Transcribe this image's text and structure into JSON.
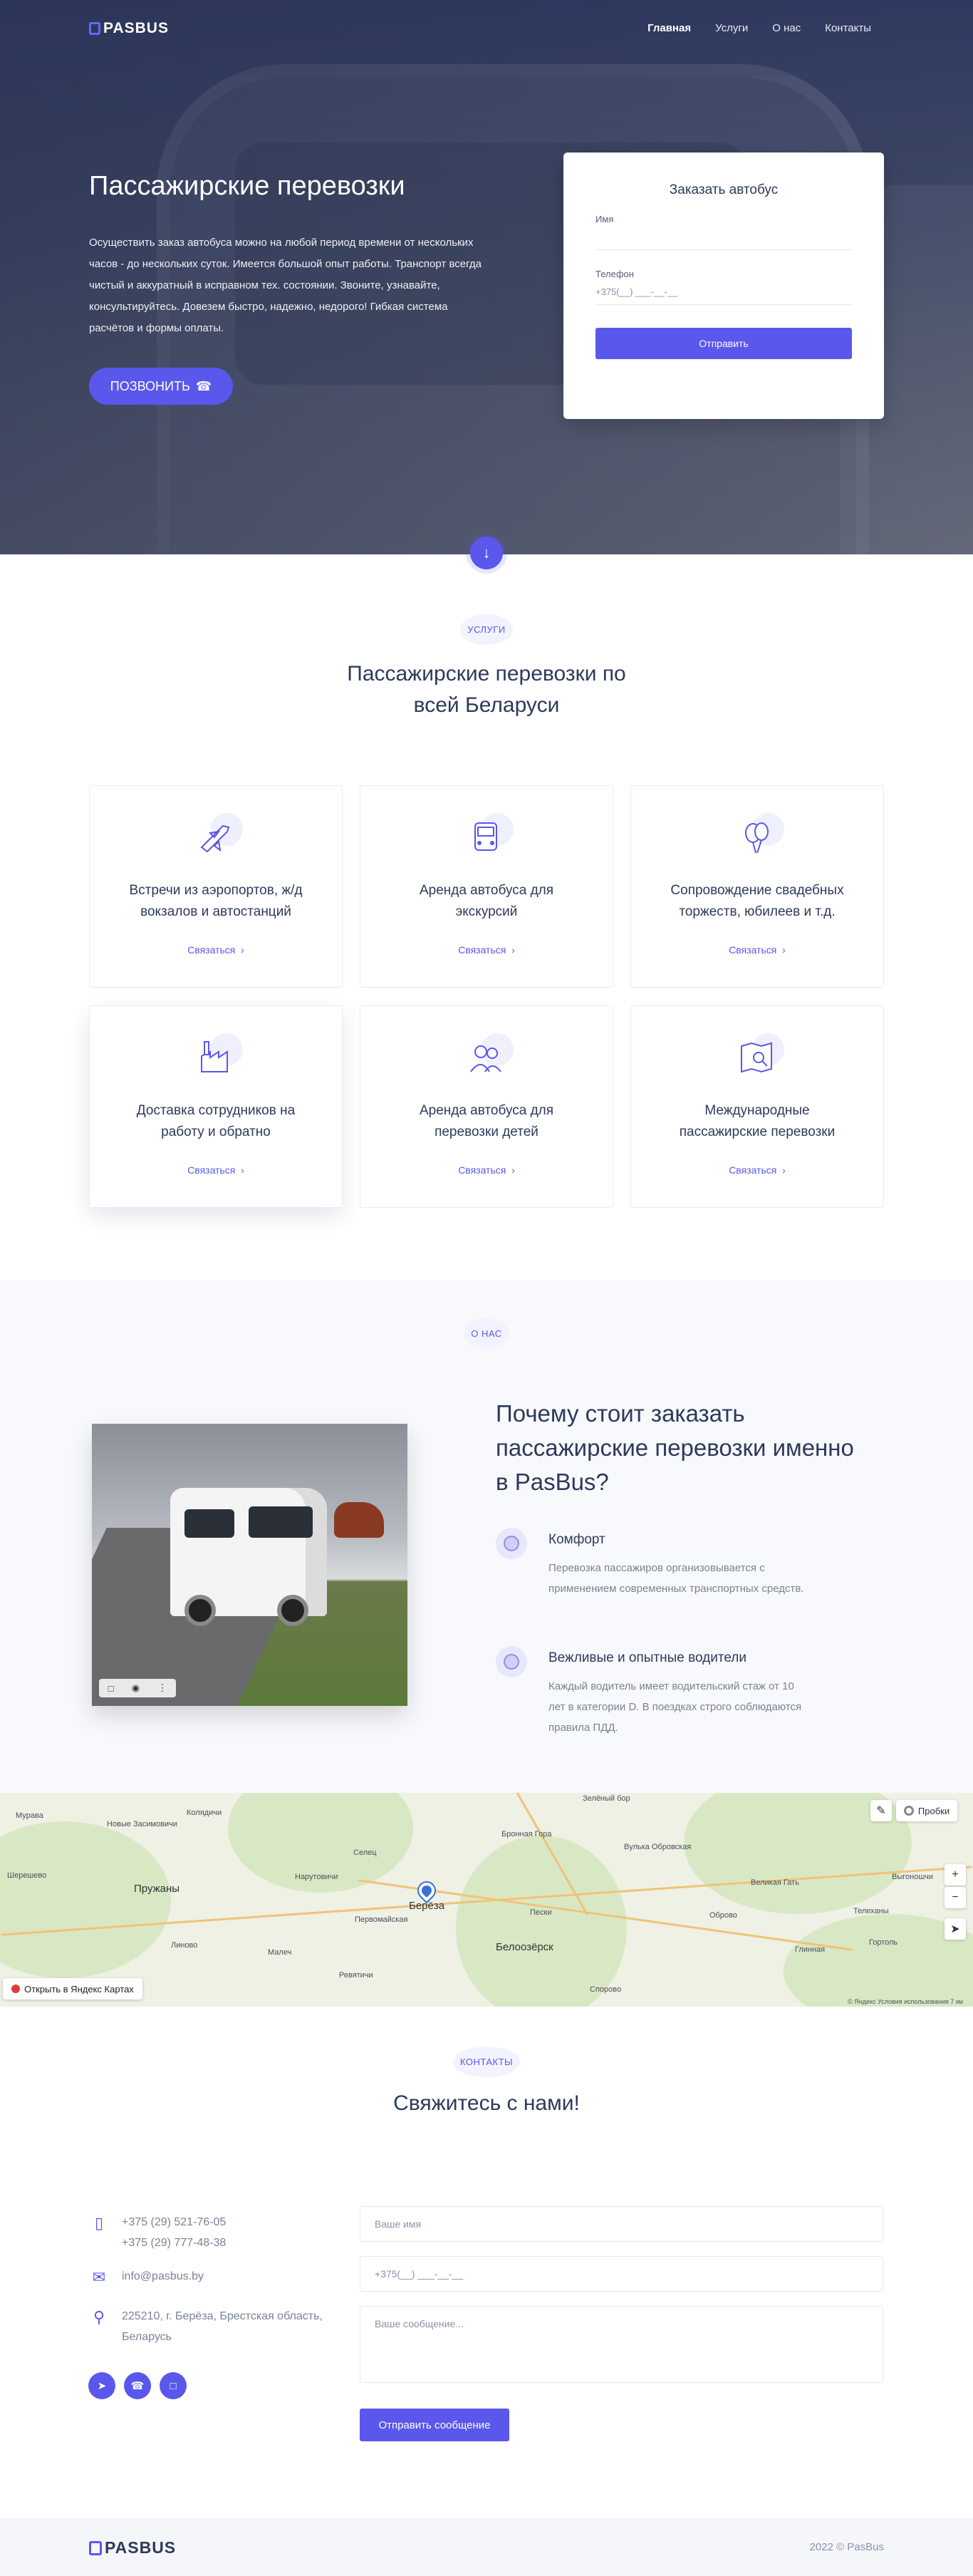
{
  "nav": {
    "logo": "PASBUS",
    "items": [
      {
        "label": "Главная",
        "active": true
      },
      {
        "label": "Услуги"
      },
      {
        "label": "О нас"
      },
      {
        "label": "Контакты"
      }
    ]
  },
  "hero": {
    "title": "Пассажирские перевозки",
    "text": "Осуществить заказ автобуса можно на любой период времени от нескольких часов - до нескольких суток. Имеется большой опыт работы. Транспорт всегда чистый и аккуратный в исправном тех. состоянии. Звоните, узнавайте, консультируйтесь. Довезем быстро, надежно, недорого! Гибкая система расчётов и формы оплаты.",
    "call_label": "ПОЗВОНИТЬ",
    "call_icon": "phone-icon"
  },
  "order_form": {
    "title": "Заказать автобус",
    "name_label": "Имя",
    "name_value": "",
    "phone_label": "Телефон",
    "phone_value": "+375(__) ___-__-__",
    "submit_label": "Отправить"
  },
  "services": {
    "tag": "УСЛУГИ",
    "title_line1": "Пассажирские перевозки по",
    "title_line2": "всей Беларуси",
    "link_label": "Связаться",
    "cards": [
      {
        "line1": "Встречи из аэропортов, ж/д",
        "line2": "вокзалов и автостанций",
        "icon": "airplane-icon"
      },
      {
        "line1": "Аренда автобуса для",
        "line2": "экскурсий",
        "icon": "bus-icon"
      },
      {
        "line1": "Сопровождение свадебных",
        "line2": "торжеств, юбилеев и т.д.",
        "icon": "balloons-icon"
      },
      {
        "line1": "Доставка сотрудников на",
        "line2": "работу и обратно",
        "icon": "factory-icon"
      },
      {
        "line1": "Аренда автобуса для",
        "line2": "перевозки детей",
        "icon": "children-icon"
      },
      {
        "line1": "Международные",
        "line2": "пассажирские перевозки",
        "icon": "map-search-icon"
      }
    ]
  },
  "about": {
    "tag": "О НАС",
    "title_line1": "Почему стоит заказать",
    "title_line2": "пассажирские перевозки именно",
    "title_line3": "в PasBus?",
    "features": [
      {
        "title": "Комфорт",
        "text": "Перевозка пассажиров организовывается с применением современных транспортных средств."
      },
      {
        "title": "Вежливые и опытные водители",
        "text": "Каждый водитель имеет водительский стаж от 10 лет в категории D. В поездках строго соблюдаются правила ПДД."
      }
    ]
  },
  "map": {
    "open_label": "Открыть в Яндекс Картах",
    "traffic_label": "Пробки",
    "zoom_in": "+",
    "zoom_out": "−",
    "footer": "© Яндекс  Условия использования     7 км",
    "labels": [
      "Муравa",
      "Новые Засимовичи",
      "Колядичи",
      "Новые Засимовичи",
      "Шерешево",
      "Пружаны",
      "Линово",
      "Малеч",
      "Селец",
      "Нарутовичи",
      "Первомайская",
      "Берёза",
      "Белоозёрск",
      "Пески",
      "Вулька Обровская",
      "Оброво",
      "Великая Гать",
      "Выгоношчи",
      "Телеханы",
      "Споровo",
      "Бронная Гора",
      "Ревятичи",
      "Глинная",
      "Гортоль",
      "Зелёный бор"
    ]
  },
  "contacts": {
    "tag": "КОНТАКТЫ",
    "title": "Свяжитесь с нами!",
    "phone1": "+375 (29) 521-76-05",
    "phone2": "+375 (29) 777-48-38",
    "email": "info@pasbus.by",
    "address_line1": "225210, г. Берёза, Брестская область,",
    "address_line2": "Беларусь",
    "socials": [
      "telegram-icon",
      "whatsapp-icon",
      "viber-icon"
    ],
    "name_placeholder": "Ваше имя",
    "phone_placeholder": "+375(__) ___-__-__",
    "message_placeholder": "Ваше сообщение...",
    "submit_label": "Отправить сообщение"
  },
  "footer": {
    "logo": "PASBUS",
    "copyright": "2022 © PasBus"
  },
  "colors": {
    "accent": "#5a57ec",
    "text": "#2d3a5a",
    "muted": "#7a8296"
  }
}
